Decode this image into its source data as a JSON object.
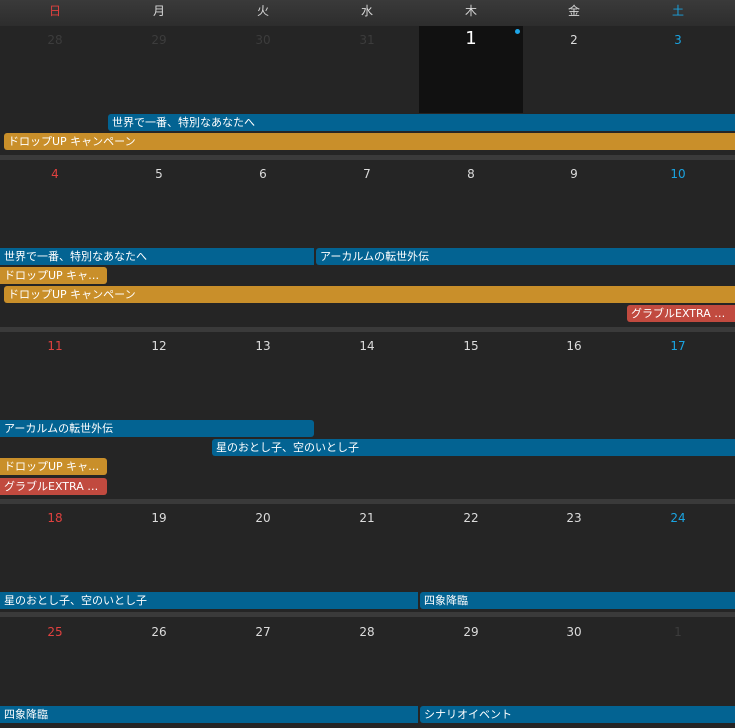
{
  "weekdays": [
    "日",
    "月",
    "火",
    "水",
    "木",
    "金",
    "土"
  ],
  "weeks": [
    {
      "days": [
        "28",
        "29",
        "30",
        "31",
        "1",
        "2",
        "3"
      ]
    },
    {
      "days": [
        "4",
        "5",
        "6",
        "7",
        "8",
        "9",
        "10"
      ]
    },
    {
      "days": [
        "11",
        "12",
        "13",
        "14",
        "15",
        "16",
        "17"
      ]
    },
    {
      "days": [
        "18",
        "19",
        "20",
        "21",
        "22",
        "23",
        "24"
      ]
    },
    {
      "days": [
        "25",
        "26",
        "27",
        "28",
        "29",
        "30",
        "1"
      ]
    }
  ],
  "events": {
    "w1_world": "世界で一番、特別なあなたへ",
    "w1_drop": "ドロップUP キャンペーン",
    "w2_world": "世界で一番、特別なあなたへ",
    "w2_arcarum": "アーカルムの転世外伝",
    "w2_drop_short": "ドロップUP キャ…",
    "w2_drop": "ドロップUP キャンペーン",
    "w2_extra": "グラブルEXTRA …",
    "w3_arcarum": "アーカルムの転世外伝",
    "w3_hoshi": "星のおとし子、空のいとし子",
    "w3_drop_short": "ドロップUP キャ…",
    "w3_extra": "グラブルEXTRA …",
    "w4_hoshi": "星のおとし子、空のいとし子",
    "w4_shisho": "四象降臨",
    "w5_shisho": "四象降臨",
    "w5_scenario": "シナリオイベント"
  },
  "colors": {
    "event_blue": "#036392",
    "event_orange": "#c98f2a",
    "event_red": "#c14a3f",
    "sunday": "#e0413f",
    "saturday": "#1aa3e0"
  }
}
